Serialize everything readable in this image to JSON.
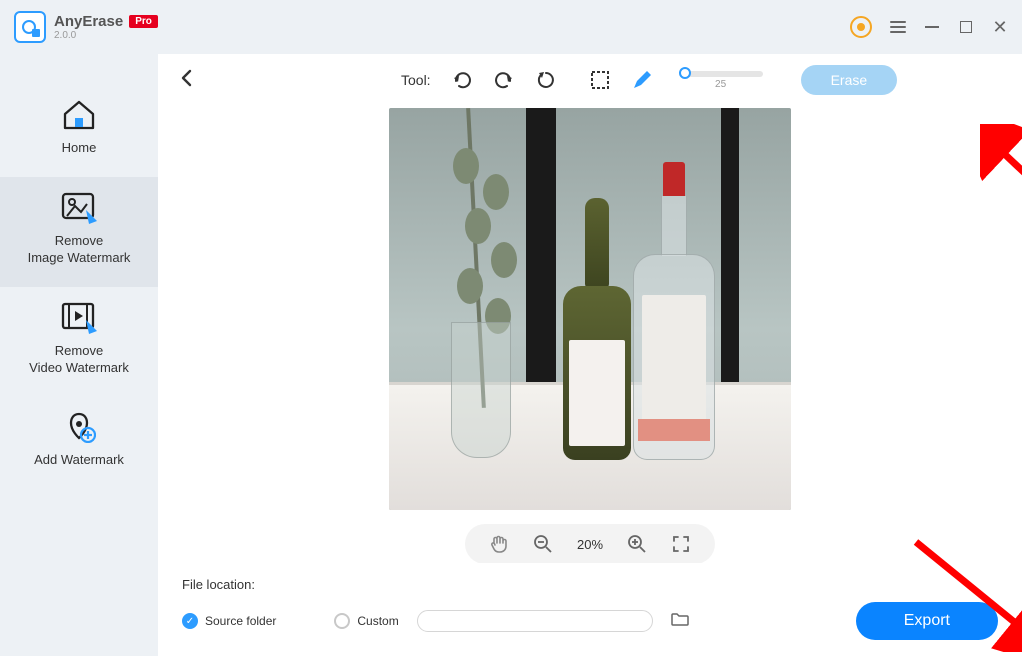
{
  "header": {
    "app_name": "AnyErase",
    "pro_badge": "Pro",
    "version": "2.0.0"
  },
  "sidebar": {
    "items": [
      {
        "label": "Home"
      },
      {
        "label": "Remove\nImage Watermark"
      },
      {
        "label": "Remove\nVideo Watermark"
      },
      {
        "label": "Add Watermark"
      }
    ],
    "active_index": 1
  },
  "toolbar": {
    "tool_label": "Tool:",
    "brush_size": "25",
    "erase_label": "Erase"
  },
  "zoom": {
    "value": "20%"
  },
  "footer": {
    "file_location_label": "File location:",
    "source_folder_label": "Source folder",
    "custom_label": "Custom",
    "export_label": "Export"
  }
}
